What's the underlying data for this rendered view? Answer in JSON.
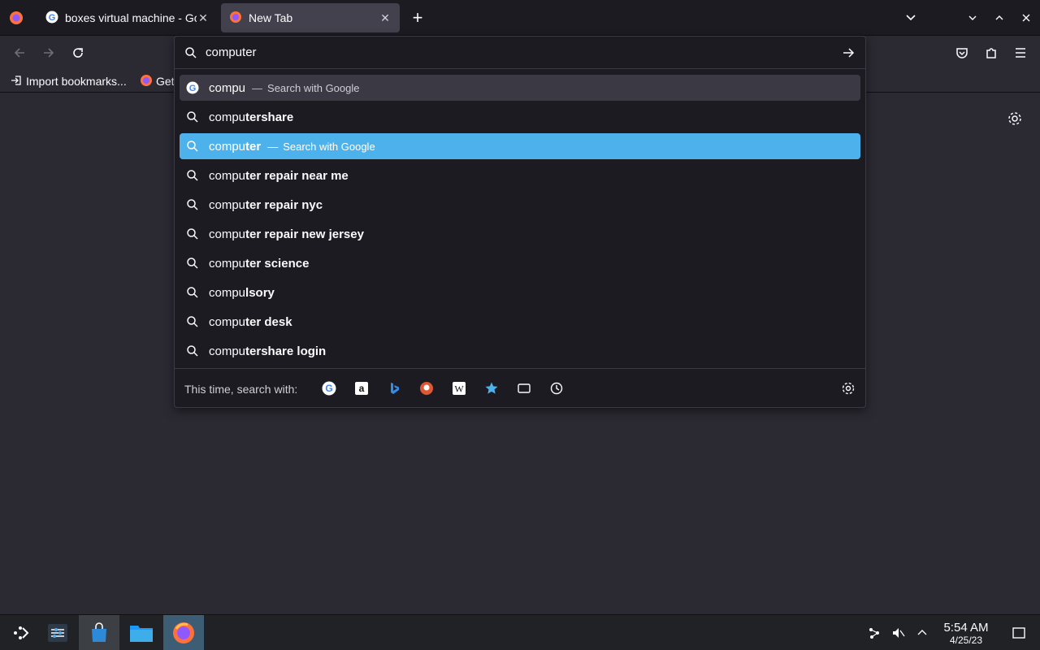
{
  "tabs": [
    {
      "title": "boxes virtual machine - Go",
      "icon": "google-g-icon",
      "close": "✕"
    },
    {
      "title": "New Tab",
      "icon": "firefox-icon",
      "close": "✕"
    }
  ],
  "new_tab_label": "+",
  "bookmarks": [
    {
      "label": "Import bookmarks...",
      "icon": "import-icon"
    },
    {
      "label": "Get",
      "icon": "firefox-icon"
    }
  ],
  "urlbar": {
    "value": "computer"
  },
  "suggestions": [
    {
      "typed": "compu",
      "rest": "",
      "action": "Search with Google",
      "dash": "—",
      "icon": "google-g-icon",
      "state": "hover"
    },
    {
      "typed": "compu",
      "rest": "tershare",
      "action": "",
      "dash": "",
      "icon": "search-icon",
      "state": ""
    },
    {
      "typed": "compu",
      "rest": "ter",
      "action": "Search with Google",
      "dash": "—",
      "icon": "search-icon",
      "state": "selected"
    },
    {
      "typed": "compu",
      "rest": "ter repair near me",
      "action": "",
      "dash": "",
      "icon": "search-icon",
      "state": ""
    },
    {
      "typed": "compu",
      "rest": "ter repair nyc",
      "action": "",
      "dash": "",
      "icon": "search-icon",
      "state": ""
    },
    {
      "typed": "compu",
      "rest": "ter repair new jersey",
      "action": "",
      "dash": "",
      "icon": "search-icon",
      "state": ""
    },
    {
      "typed": "compu",
      "rest": "ter science",
      "action": "",
      "dash": "",
      "icon": "search-icon",
      "state": ""
    },
    {
      "typed": "compu",
      "rest": "lsory",
      "action": "",
      "dash": "",
      "icon": "search-icon",
      "state": ""
    },
    {
      "typed": "compu",
      "rest": "ter desk",
      "action": "",
      "dash": "",
      "icon": "search-icon",
      "state": ""
    },
    {
      "typed": "compu",
      "rest": "tershare login",
      "action": "",
      "dash": "",
      "icon": "search-icon",
      "state": ""
    }
  ],
  "oneoff": {
    "label": "This time, search with:",
    "engines": [
      "google-icon",
      "amazon-icon",
      "bing-icon",
      "duckduckgo-icon",
      "wikipedia-icon",
      "bookmarks-star-icon",
      "tabs-icon",
      "history-icon"
    ]
  },
  "taskbar": {
    "time": "5:54 AM",
    "date": "4/25/23"
  },
  "colors": {
    "accent": "#4db2ec",
    "background": "#2b2a33",
    "popup": "#1c1b22"
  }
}
